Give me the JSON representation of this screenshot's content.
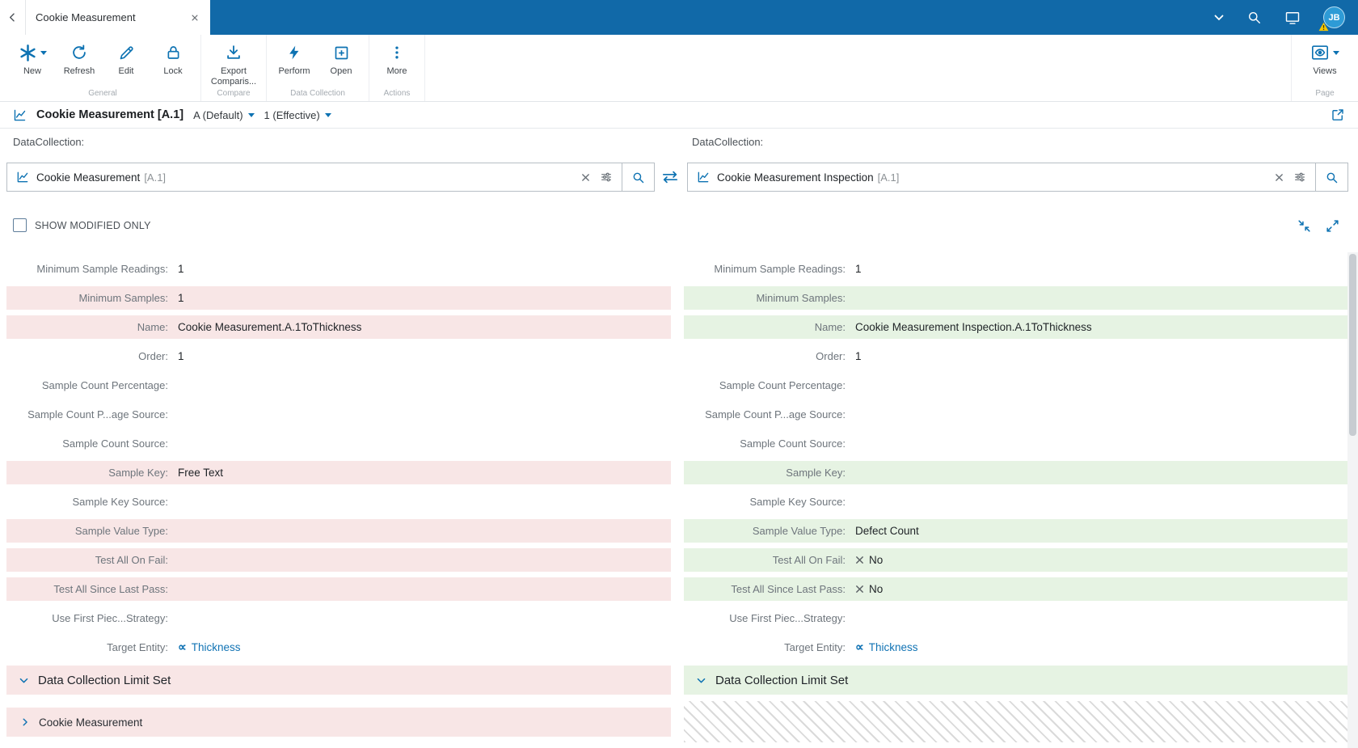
{
  "colors": {
    "accent": "#0D72B2",
    "topbar": "#1169A8",
    "modified_left_bg": "#F8E6E6",
    "modified_right_bg": "#E6F3E3",
    "link": "#1173B4"
  },
  "topbar": {
    "tab_title": "Cookie Measurement",
    "avatar_initials": "JB"
  },
  "ribbon": {
    "new_label": "New",
    "refresh_label": "Refresh",
    "edit_label": "Edit",
    "lock_label": "Lock",
    "export_label": "Export Comparis...",
    "perform_label": "Perform",
    "open_label": "Open",
    "more_label": "More",
    "views_label": "Views",
    "group_general": "General",
    "group_compare": "Compare",
    "group_data_collection": "Data Collection",
    "group_actions": "Actions",
    "group_page": "Page"
  },
  "breadcrumb": {
    "title": "Cookie Measurement [A.1]",
    "version": "A (Default)",
    "revision": "1 (Effective)"
  },
  "selectors": {
    "left": {
      "label": "DataCollection:",
      "value": "Cookie Measurement",
      "suffix": "[A.1]"
    },
    "right": {
      "label": "DataCollection:",
      "value": "Cookie Measurement Inspection",
      "suffix": "[A.1]"
    }
  },
  "filter_bar": {
    "show_modified_label": "SHOW MODIFIED ONLY"
  },
  "comparison": {
    "section_header": "Data Collection Limit Set",
    "collapsed_item": "Cookie Measurement",
    "rows": [
      {
        "label": "Minimum Sample Readings:",
        "left": {
          "value": "1",
          "modified": false
        },
        "right": {
          "value": "1",
          "modified": false
        }
      },
      {
        "label": "Minimum Samples:",
        "left": {
          "value": "1",
          "modified": true
        },
        "right": {
          "value": "",
          "modified": true
        }
      },
      {
        "label": "Name:",
        "left": {
          "value": "Cookie Measurement.A.1ToThickness",
          "modified": true
        },
        "right": {
          "value": "Cookie Measurement Inspection.A.1ToThickness",
          "modified": true
        }
      },
      {
        "label": "Order:",
        "left": {
          "value": "1",
          "modified": false
        },
        "right": {
          "value": "1",
          "modified": false
        }
      },
      {
        "label": "Sample Count Percentage:",
        "left": {
          "value": "",
          "modified": false
        },
        "right": {
          "value": "",
          "modified": false
        }
      },
      {
        "label": "Sample Count P...age Source:",
        "left": {
          "value": "",
          "modified": false
        },
        "right": {
          "value": "",
          "modified": false
        }
      },
      {
        "label": "Sample Count Source:",
        "left": {
          "value": "",
          "modified": false
        },
        "right": {
          "value": "",
          "modified": false
        }
      },
      {
        "label": "Sample Key:",
        "left": {
          "value": "Free Text",
          "modified": true
        },
        "right": {
          "value": "",
          "modified": true
        }
      },
      {
        "label": "Sample Key Source:",
        "left": {
          "value": "",
          "modified": false
        },
        "right": {
          "value": "",
          "modified": false
        }
      },
      {
        "label": "Sample Value Type:",
        "left": {
          "value": "",
          "modified": true
        },
        "right": {
          "value": "Defect Count",
          "modified": true
        }
      },
      {
        "label": "Test All On Fail:",
        "left": {
          "value": "",
          "modified": true
        },
        "right": {
          "value": "No",
          "modified": true,
          "icon": "x"
        }
      },
      {
        "label": "Test All Since Last Pass:",
        "left": {
          "value": "",
          "modified": true
        },
        "right": {
          "value": "No",
          "modified": true,
          "icon": "x"
        }
      },
      {
        "label": "Use First Piec...Strategy:",
        "left": {
          "value": "",
          "modified": false
        },
        "right": {
          "value": "",
          "modified": false
        }
      },
      {
        "label": "Target Entity:",
        "left": {
          "value": "Thickness",
          "modified": false,
          "icon": "entity",
          "link": true
        },
        "right": {
          "value": "Thickness",
          "modified": false,
          "icon": "entity",
          "link": true
        }
      }
    ]
  }
}
